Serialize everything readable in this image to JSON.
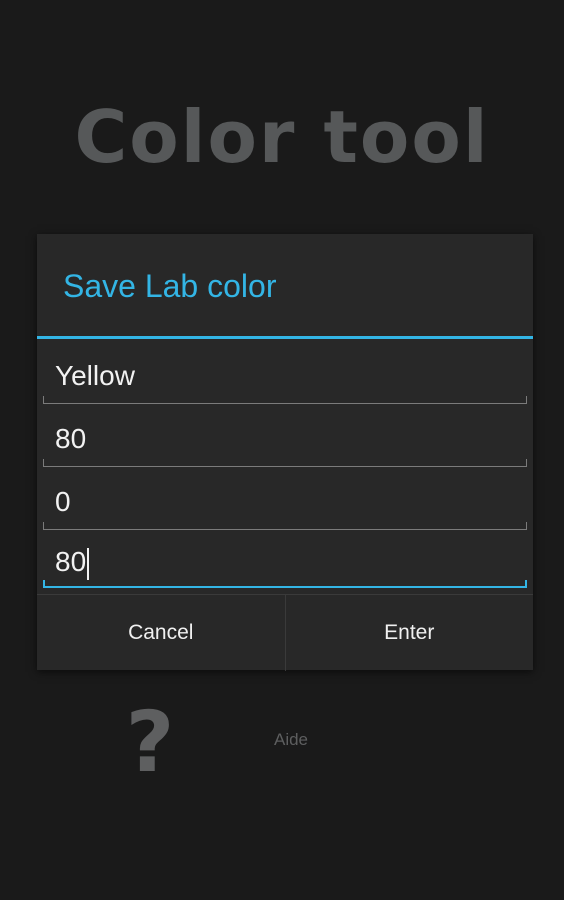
{
  "app": {
    "title": "Color tool"
  },
  "dialog": {
    "title": "Save Lab color",
    "fields": [
      {
        "value": "Yellow"
      },
      {
        "value": "80"
      },
      {
        "value": "0"
      },
      {
        "value": "80"
      }
    ],
    "cancel_label": "Cancel",
    "enter_label": "Enter"
  },
  "help": {
    "icon": "question-mark-icon",
    "label": "Aide"
  },
  "colors": {
    "accent": "#33b5e5",
    "background": "#1a1a1a",
    "dialog": "#282828"
  }
}
